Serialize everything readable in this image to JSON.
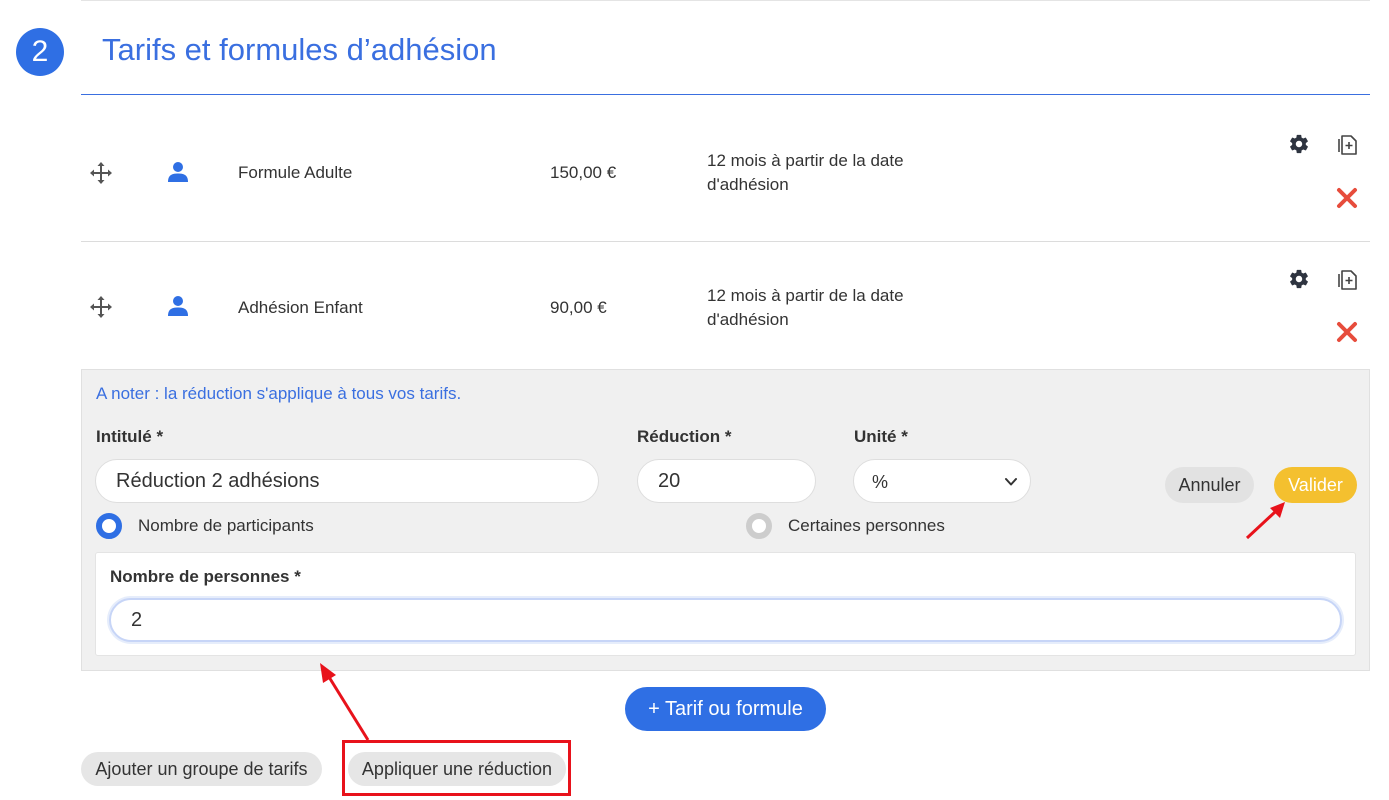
{
  "section": {
    "step_number": "2",
    "title": "Tarifs et formules d’adhésion"
  },
  "rates": [
    {
      "name": "Formule Adulte",
      "price": "150,00 €",
      "duration": "12 mois à partir de la date d'adhésion"
    },
    {
      "name": "Adhésion Enfant",
      "price": "90,00 €",
      "duration": "12 mois à partir de la date d'adhésion"
    }
  ],
  "reduction_form": {
    "note": "A noter : la réduction s'applique à tous vos tarifs.",
    "label_field": {
      "label": "Intitulé *",
      "value": "Réduction 2 adhésions"
    },
    "amount_field": {
      "label": "Réduction *",
      "value": "20"
    },
    "unit_field": {
      "label": "Unité *",
      "selected": "%"
    },
    "cancel_label": "Annuler",
    "validate_label": "Valider",
    "radio_participants": {
      "label": "Nombre de participants",
      "checked": true
    },
    "radio_certain": {
      "label": "Certaines personnes",
      "checked": false
    },
    "persons_field": {
      "label": "Nombre de personnes *",
      "value": "2"
    }
  },
  "actions": {
    "add_rate_label": "+ Tarif ou formule",
    "add_group_label": "Ajouter un groupe de tarifs",
    "apply_reduction_label": "Appliquer une réduction"
  },
  "colors": {
    "primary": "#2f6fe4",
    "validate": "#f4c02f",
    "delete": "#e74c3c",
    "annotation": "#e8121b"
  }
}
